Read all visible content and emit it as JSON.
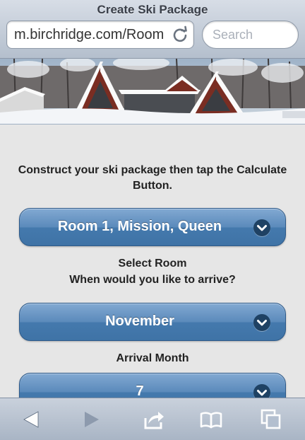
{
  "browser": {
    "title": "Create Ski Package",
    "url": "m.birchridge.com/Room",
    "search_placeholder": "Search"
  },
  "banner": {
    "icon": "lodge-photo"
  },
  "main": {
    "intro": "Construct your ski package then tap the Calculate Button.",
    "room_select": {
      "value": "Room 1, Mission, Queen",
      "caption": "Select Room"
    },
    "arrive_question": "When would you like to arrive?",
    "month_select": {
      "value": "November",
      "caption": "Arrival Month"
    },
    "day_select": {
      "value": "7"
    }
  },
  "toolbar": {
    "back": "back-arrow-icon",
    "forward": "forward-arrow-icon",
    "share": "share-icon",
    "bookmarks": "bookmarks-icon",
    "tabs": "tabs-icon"
  },
  "colors": {
    "button_blue": "#4a7fb3",
    "chevron_bg": "#1f4264"
  }
}
